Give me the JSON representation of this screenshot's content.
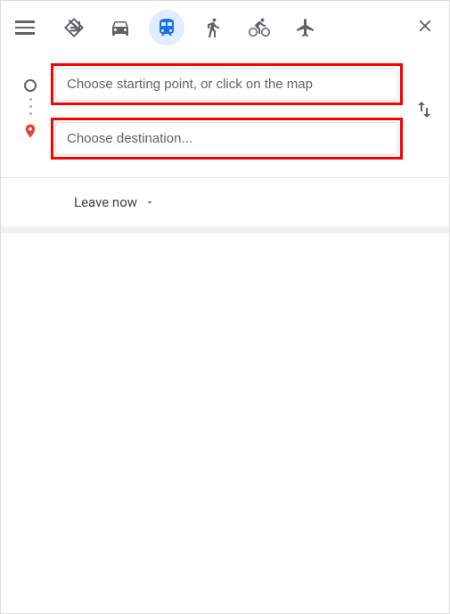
{
  "header": {
    "modes": {
      "best": "Best travel modes",
      "driving": "Driving",
      "transit": "Transit",
      "walking": "Walking",
      "cycling": "Cycling",
      "flights": "Flights"
    },
    "active_mode": "transit",
    "close_label": "Close"
  },
  "inputs": {
    "start_placeholder": "Choose starting point, or click on the map",
    "start_value": "",
    "destination_placeholder": "Choose destination...",
    "destination_value": "",
    "swap_label": "Reverse starting point and destination"
  },
  "options": {
    "depart_label": "Leave now"
  }
}
